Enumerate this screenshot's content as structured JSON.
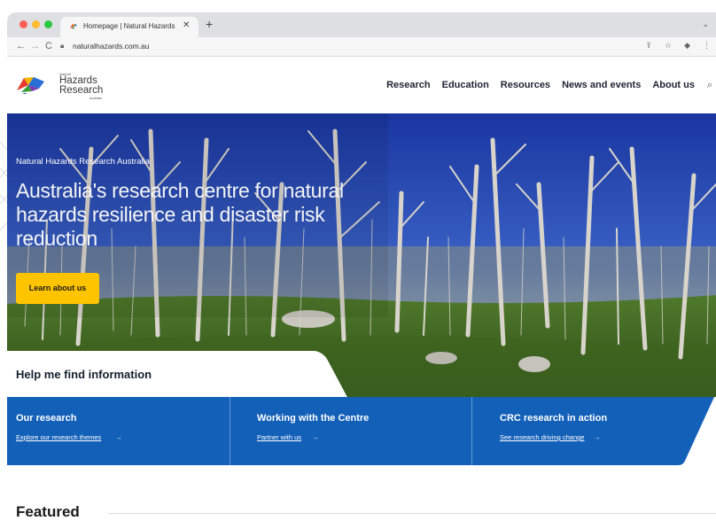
{
  "browser": {
    "tab_title": "Homepage | Natural Hazards R",
    "tab_close": "✕",
    "new_tab": "+",
    "url": "naturalhazards.com.au",
    "back_icon": "←",
    "forward_icon": "→",
    "reload_icon": "C"
  },
  "logo": {
    "small": "Natural",
    "line1": "Hazards",
    "line2": "Research",
    "sub": "Australia"
  },
  "nav": {
    "items": [
      "Research",
      "Education",
      "Resources",
      "News and events",
      "About us"
    ]
  },
  "hero": {
    "kicker": "Natural Hazards Research Australia",
    "title": "Australia's research centre for natural hazards resilience and disaster risk reduction",
    "cta": "Learn about us"
  },
  "help": {
    "title": "Help me find information"
  },
  "cards": [
    {
      "title": "Our research",
      "link": "Explore our research themes"
    },
    {
      "title": "Working with the Centre",
      "link": "Partner with us"
    },
    {
      "title": "CRC research in action",
      "link": "See research driving change"
    }
  ],
  "featured": {
    "title": "Featured"
  },
  "colors": {
    "brand_blue": "#1360b8",
    "cta_yellow": "#ffc400",
    "sky": "#1f3fa8"
  }
}
